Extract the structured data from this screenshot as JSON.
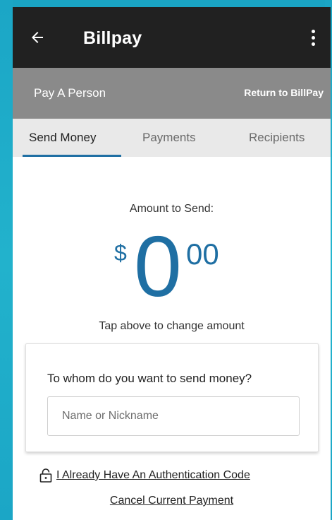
{
  "appbar": {
    "title": "Billpay",
    "back_icon": "arrow-left-icon",
    "more_icon": "more-vertical-icon"
  },
  "subheader": {
    "title": "Pay A Person",
    "return_link": "Return to BillPay"
  },
  "tabs": [
    {
      "label": "Send Money",
      "active": true
    },
    {
      "label": "Payments",
      "active": false
    },
    {
      "label": "Recipients",
      "active": false
    }
  ],
  "amount": {
    "label": "Amount to Send:",
    "currency": "$",
    "whole": "0",
    "cents": "00",
    "hint": "Tap above to change amount"
  },
  "recipient": {
    "question": "To whom do you want to send money?",
    "input_value": "",
    "input_placeholder": "Name or Nickname"
  },
  "links": {
    "auth_code": "I Already Have An Authentication Code",
    "auth_icon": "lock-icon",
    "cancel": "Cancel Current Payment"
  },
  "colors": {
    "accent": "#1f6fa3",
    "appbar": "#212121",
    "subheader": "#8a8a8a",
    "background": "#1aa4c4"
  }
}
